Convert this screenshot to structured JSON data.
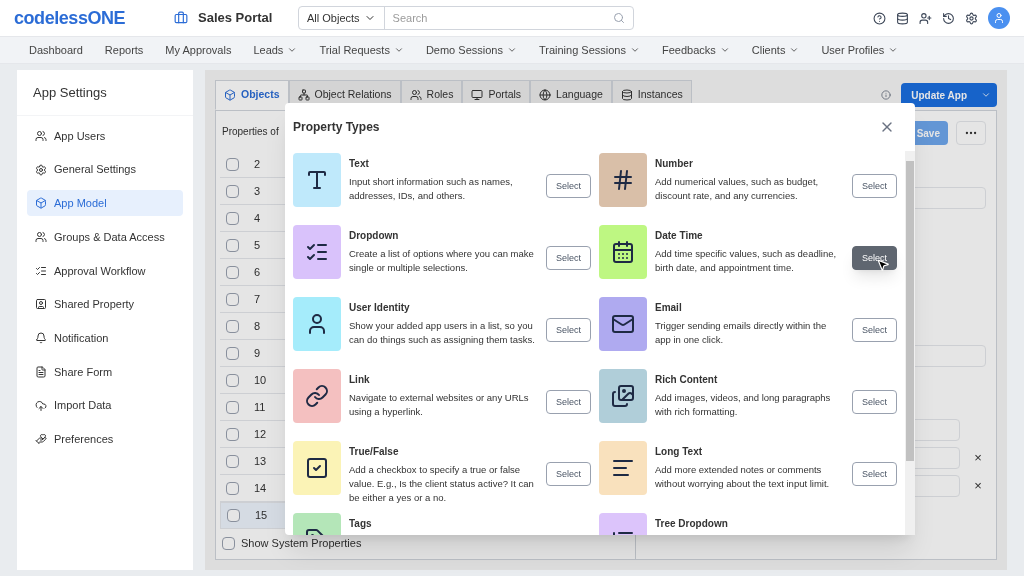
{
  "header": {
    "logo": "codelessONE",
    "app_name": "Sales Portal",
    "object_filter": "All Objects",
    "search": {
      "placeholder": "Search"
    }
  },
  "nav": [
    {
      "label": "Dashboard",
      "has_menu": false
    },
    {
      "label": "Reports",
      "has_menu": false
    },
    {
      "label": "My Approvals",
      "has_menu": false
    },
    {
      "label": "Leads",
      "has_menu": true
    },
    {
      "label": "Trial Requests",
      "has_menu": true
    },
    {
      "label": "Demo Sessions",
      "has_menu": true
    },
    {
      "label": "Training Sessions",
      "has_menu": true
    },
    {
      "label": "Feedbacks",
      "has_menu": true
    },
    {
      "label": "Clients",
      "has_menu": true
    },
    {
      "label": "User Profiles",
      "has_menu": true
    }
  ],
  "sidebar": {
    "title": "App Settings",
    "items": [
      {
        "label": "App Users",
        "selected": false
      },
      {
        "label": "General Settings",
        "selected": false
      },
      {
        "label": "App Model",
        "selected": true
      },
      {
        "label": "Groups & Data Access",
        "selected": false
      },
      {
        "label": "Approval Workflow",
        "selected": false
      },
      {
        "label": "Shared Property",
        "selected": false
      },
      {
        "label": "Notification",
        "selected": false
      },
      {
        "label": "Share Form",
        "selected": false
      },
      {
        "label": "Import Data",
        "selected": false
      },
      {
        "label": "Preferences",
        "selected": false
      }
    ]
  },
  "tabs": [
    {
      "label": "Objects",
      "selected": true
    },
    {
      "label": "Object Relations",
      "selected": false
    },
    {
      "label": "Roles",
      "selected": false
    },
    {
      "label": "Portals",
      "selected": false
    },
    {
      "label": "Language",
      "selected": false
    },
    {
      "label": "Instances",
      "selected": false
    }
  ],
  "update_button": "Update App",
  "properties_label": "Properties of",
  "rows": [
    {
      "number": "2",
      "checked": false,
      "selected": false
    },
    {
      "number": "3",
      "checked": false,
      "selected": false
    },
    {
      "number": "4",
      "checked": false,
      "selected": false
    },
    {
      "number": "5",
      "checked": false,
      "selected": false
    },
    {
      "number": "6",
      "checked": false,
      "selected": false
    },
    {
      "number": "7",
      "checked": false,
      "selected": false
    },
    {
      "number": "8",
      "checked": false,
      "selected": false
    },
    {
      "number": "9",
      "checked": false,
      "selected": false
    },
    {
      "number": "10",
      "checked": false,
      "selected": false
    },
    {
      "number": "11",
      "checked": false,
      "selected": false
    },
    {
      "number": "12",
      "checked": false,
      "selected": false
    },
    {
      "number": "13",
      "checked": false,
      "selected": false
    },
    {
      "number": "14",
      "checked": false,
      "selected": false
    },
    {
      "number": "15",
      "checked": false,
      "selected": true
    }
  ],
  "show_system": {
    "label": "Show System Properties",
    "checked": false
  },
  "save_button": "Save",
  "remove_marks": [
    "×",
    "×"
  ],
  "dialog": {
    "title": "Property Types",
    "types": [
      {
        "title": "Text",
        "description": "Input short information such as names, addresses, IDs, and others.",
        "color": "#bfe9fb",
        "button": "Select",
        "hovered": false
      },
      {
        "title": "Number",
        "description": "Add numerical values, such as budget, discount rate, and any currencies.",
        "color": "#d9bfa8",
        "button": "Select",
        "hovered": false
      },
      {
        "title": "Dropdown",
        "description": "Create a list of options where you can make single or multiple selections.",
        "color": "#d9c2fb",
        "button": "Select",
        "hovered": false
      },
      {
        "title": "Date Time",
        "description": "Add time specific values, such as deadline, birth date, and appointment time.",
        "color": "#bef782",
        "button": "Select",
        "hovered": true
      },
      {
        "title": "User Identity",
        "description": "Show your added app users in a list, so you can do things such as assigning them tasks.",
        "color": "#a5ecfb",
        "button": "Select",
        "hovered": false
      },
      {
        "title": "Email",
        "description": "Trigger sending emails directly within the app in one click.",
        "color": "#afaaf0",
        "button": "Select",
        "hovered": false
      },
      {
        "title": "Link",
        "description": "Navigate to external websites or any URLs using a hyperlink.",
        "color": "#f4c0c0",
        "button": "Select",
        "hovered": false
      },
      {
        "title": "Rich Content",
        "description": "Add images, videos, and long paragraphs with rich formatting.",
        "color": "#b0ced9",
        "button": "Select",
        "hovered": false
      },
      {
        "title": "True/False",
        "description": "Add a checkbox to specify a true or false value. E.g., Is the client status active? It can be either a yes or a no.",
        "color": "#fbf3b6",
        "button": "Select",
        "hovered": false
      },
      {
        "title": "Long Text",
        "description": "Add more extended notes or comments without worrying about the text input limit.",
        "color": "#f9e1bd",
        "button": "Select",
        "hovered": false
      },
      {
        "title": "Tags",
        "color": "#b4e6b8"
      },
      {
        "title": "Tree Dropdown",
        "color": "#dcc4fb"
      }
    ]
  }
}
